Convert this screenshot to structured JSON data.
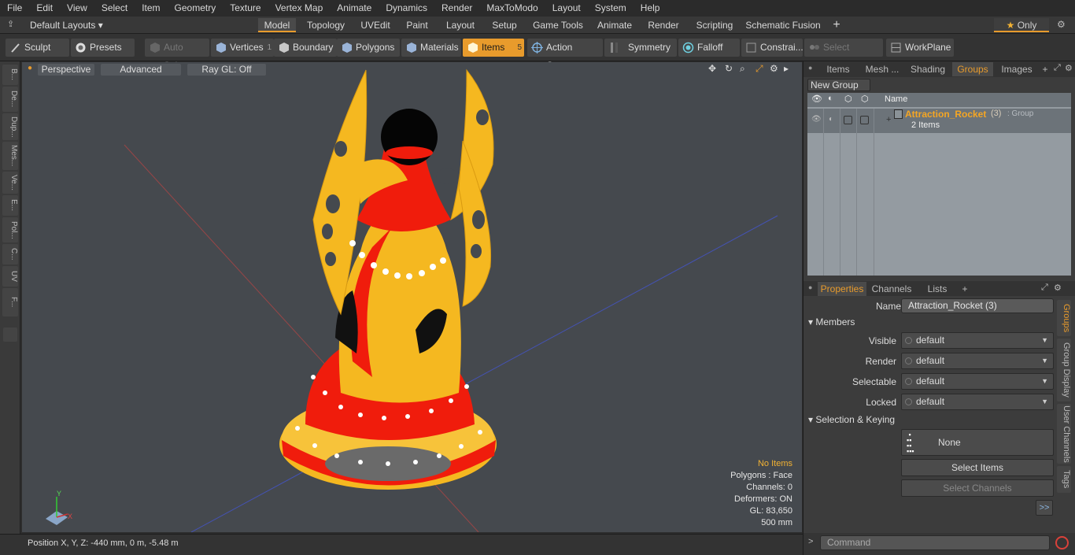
{
  "menu": [
    "File",
    "Edit",
    "View",
    "Select",
    "Item",
    "Geometry",
    "Texture",
    "Vertex Map",
    "Animate",
    "Dynamics",
    "Render",
    "MaxToModo",
    "Layout",
    "System",
    "Help"
  ],
  "layout": {
    "default_layouts": "Default Layouts",
    "tabs": [
      "Model",
      "Topology",
      "UVEdit",
      "Paint",
      "Layout",
      "Setup",
      "Game Tools",
      "Animate",
      "Render",
      "Scripting",
      "Schematic Fusion"
    ],
    "active_tab": "Model",
    "plus": "+",
    "only": "Only"
  },
  "toolbar": {
    "sculpt": "Sculpt",
    "presets": "Presets",
    "auto_select": "Auto Select",
    "vertices": "Vertices",
    "vertices_count": "1",
    "boundary": "Boundary",
    "polygons": "Polygons",
    "materials": "Materials",
    "items": "Items",
    "items_count": "5",
    "action_center": "Action Center",
    "symmetry": "Symmetry",
    "falloff": "Falloff",
    "constraints": "Constrai...",
    "select_through": "Select Through",
    "workplane": "WorkPlane"
  },
  "left_strip": [
    "B...",
    "De...",
    "Dup...",
    "Mes...",
    "Ve...",
    "E...",
    "Pol...",
    "C...",
    "UV",
    "F..."
  ],
  "viewport": {
    "perspective": "Perspective",
    "advanced": "Advanced",
    "raygl": "Ray GL: Off",
    "info": {
      "no_items": "No Items",
      "polygons": "Polygons : Face",
      "channels": "Channels: 0",
      "deformers": "Deformers: ON",
      "gl": "GL: 83,650",
      "scale": "500 mm"
    },
    "axis_y": "Y",
    "axis_x": "X"
  },
  "status": {
    "position": "Position X, Y, Z:  -440 mm, 0 m, -5.48 m"
  },
  "groups_panel": {
    "tabs": [
      "Items",
      "Mesh ...",
      "Shading",
      "Groups",
      "Images"
    ],
    "active_tab": "Groups",
    "plus": "+",
    "new_group": "New Group",
    "name_header": "Name",
    "group_name": "Attraction_Rocket",
    "group_suffix": "(3)",
    "group_type": ": Group",
    "group_items": "2 Items"
  },
  "properties_panel": {
    "tabs": [
      "Properties",
      "Channels",
      "Lists"
    ],
    "active_tab": "Properties",
    "plus": "+",
    "name_label": "Name",
    "name_value": "Attraction_Rocket (3)",
    "members": "Members",
    "fields": [
      {
        "label": "Visible",
        "value": "default"
      },
      {
        "label": "Render",
        "value": "default"
      },
      {
        "label": "Selectable",
        "value": "default"
      },
      {
        "label": "Locked",
        "value": "default"
      }
    ],
    "selection_keying": "Selection & Keying",
    "none": "None",
    "select_items": "Select Items",
    "select_channels": "Select Channels",
    "more": ">>",
    "side_tabs": [
      "Groups",
      "Group Display",
      "User Channels",
      "Tags"
    ]
  },
  "command": {
    "prompt": ">",
    "placeholder": "Command"
  },
  "colors": {
    "accent": "#e89b2c",
    "viewport_bg": "#45494e",
    "model_red": "#f01c0c",
    "model_yellow": "#f5b820"
  }
}
